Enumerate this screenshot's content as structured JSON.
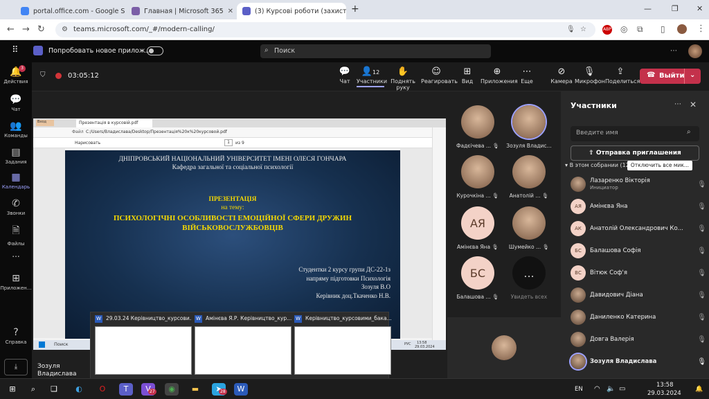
{
  "browser": {
    "tabs": [
      {
        "title": "portal.office.com - Google Sear"
      },
      {
        "title": "Главная | Microsoft 365"
      },
      {
        "title": "(3) Курсові роботи (захист)"
      }
    ],
    "new_tab": "+",
    "url": "teams.microsoft.com/_#/modern-calling/"
  },
  "teams": {
    "try_new": "Попробовать новое прилож...",
    "search": "Поиск",
    "rail": {
      "activity": "Действия",
      "activity_badge": "3",
      "chat": "Чат",
      "teams": "Команды",
      "tasks": "Задания",
      "calendar": "Календарь",
      "calls": "Звонки",
      "files": "Файлы",
      "more": "...",
      "apps": "Приложен...",
      "help": "Справка"
    },
    "timer": "03:05:12",
    "toolbar": {
      "chat": "Чат",
      "participants": "Участники",
      "participants_count": "12",
      "raise": "Поднять руку",
      "react": "Реагировать",
      "view": "Вид",
      "apps": "Приложения",
      "more": "Еще",
      "camera": "Камера",
      "mic": "Микрофон",
      "share": "Поделиться",
      "leave": "Выйти"
    }
  },
  "shared_screen": {
    "pdf_tab": "Презентація в курсовій.pdf",
    "file_label": "Файл",
    "path": "C:/Users/Владислава/Desktop/Презентація%20к%20курсовой.pdf",
    "draw": "Нарисовать",
    "page": "1",
    "page_of": "из 9",
    "start": "Пуск",
    "search": "Поиск",
    "time": "13:58",
    "date": "29.03.2024",
    "lang": "РУС"
  },
  "slide": {
    "line1": "ДНІПРОВСЬКИЙ НАЦІОНАЛЬНИЙ УНІВЕРСИТЕТ ІМЕНІ ОЛЕСЯ ГОНЧАРА",
    "line2": "Кафедра загальної та соціальної психології",
    "pres": "ПРЕЗЕНТАЦІЯ",
    "on_theme": "на тему:",
    "title1": "ПСИХОЛОГІЧНІ ОСОБЛИВОСТІ ЕМОЦІЙНОЇ СФЕРИ ДРУЖИН",
    "title2": "ВІЙСЬКОВОСЛУЖБОВЦІВ",
    "a1": "Студентки 2 курсу групи ДС-22-1з",
    "a2": "напряму підготовки Психологія",
    "a3": "Зозуля В.О",
    "a4": "Керівник доц.Ткаченко Н.В."
  },
  "gallery": [
    {
      "name": "Фадєічева ...",
      "initials": ""
    },
    {
      "name": "Зозуля Владис...",
      "initials": ""
    },
    {
      "name": "Курочкіна ...",
      "initials": ""
    },
    {
      "name": "Анатолій ...",
      "initials": ""
    },
    {
      "name": "Амінєва Яна",
      "initials": "АЯ"
    },
    {
      "name": "Шумейко ...",
      "initials": ""
    },
    {
      "name": "Балашова ...",
      "initials": "БС"
    },
    {
      "name": "Увидеть всех",
      "initials": "..."
    }
  ],
  "presenter_label": "Зозуля Владислава",
  "panel": {
    "title": "Участники",
    "search_ph": "Введите имя",
    "invite": "Отправка приглашения",
    "section": "В этом собрании (12)",
    "mute_all": "Отключить все мик...",
    "people": [
      {
        "name": "Лазаренко Вікторія",
        "role": "Инициатор",
        "initials": ""
      },
      {
        "name": "Амінєва Яна",
        "initials": "АЯ"
      },
      {
        "name": "Анатолій Олександрович Ко...",
        "initials": "АК"
      },
      {
        "name": "Балашова Софія",
        "initials": "БС"
      },
      {
        "name": "Вітюк Соф'я",
        "initials": "ВС"
      },
      {
        "name": "Давидович Діана",
        "initials": ""
      },
      {
        "name": "Даниленко Катерина",
        "initials": ""
      },
      {
        "name": "Довга Валерія",
        "initials": ""
      },
      {
        "name": "Зозуля Владислава",
        "initials": ""
      }
    ]
  },
  "thumbs": [
    {
      "title": "29.03.24 Керівництво_курсови..."
    },
    {
      "title": "Амінєва Я.Р. Керівництво_кур..."
    },
    {
      "title": "Керівництво_курсовими_бака..."
    }
  ],
  "taskbar": {
    "badge1": "27",
    "badge2": "28",
    "lang": "EN",
    "time": "13:58",
    "date": "29.03.2024"
  }
}
